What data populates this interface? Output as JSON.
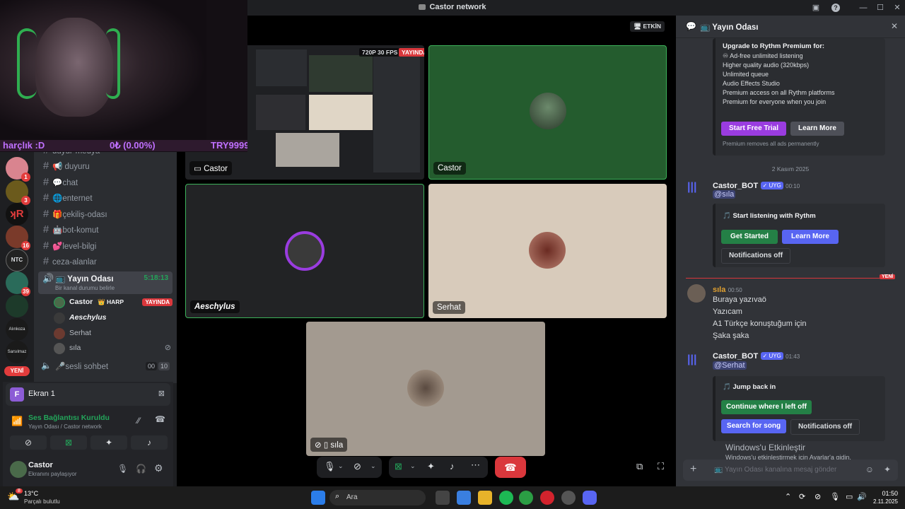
{
  "window": {
    "title": "Castor network"
  },
  "servers": [
    {
      "badge": "1"
    },
    {
      "badge": "3"
    },
    {
      "badge": ""
    },
    {
      "badge": "16"
    },
    {
      "badge": ""
    },
    {
      "badge": "39"
    },
    {
      "badge": ""
    },
    {
      "badge": ""
    },
    {
      "badge": ""
    },
    {
      "badge": "13"
    }
  ],
  "server_new_label": "YENİ",
  "channels": {
    "partial": "duyur-medya",
    "items": [
      "📢 duyuru",
      "💬chat",
      "🌐enternet",
      "🎁çekiliş-odası",
      "🤖bot-komut",
      "💕level-bilgi",
      "ceza-alanlar"
    ],
    "voice": {
      "name": "📺 Yayın Odası",
      "time": "5:18:13",
      "status": "Bir kanal durumu belirle",
      "members": [
        {
          "name": "Castor",
          "tag": "👑 HARP",
          "live": "YAYINDA"
        },
        {
          "name": "Aeschylus"
        },
        {
          "name": "Serhat"
        },
        {
          "name": "sıla"
        }
      ]
    },
    "voice2": {
      "name": "🎤sesli sohbet",
      "count1": "00",
      "count2": "10"
    }
  },
  "overlay": {
    "ticker_left": "harçlık :D",
    "ticker_mid": "0₺ (0.00%)",
    "ticker_right": "TRY999999"
  },
  "ekran": {
    "icon": "F",
    "name": "Ekran 1"
  },
  "voice_panel": {
    "status": "Ses Bağlantısı Kuruldu",
    "sub": "Yayın Odası / Castor network"
  },
  "user": {
    "name": "Castor",
    "status": "Ekranını paylaşıyor"
  },
  "stage": {
    "active_badge": "ETKİN",
    "stream_badge": "720P 30 FPS",
    "live_badge": "YAYINDA",
    "tiles": [
      "Castor",
      "Castor",
      "Aeschylus",
      "Serhat",
      "sıla"
    ]
  },
  "chat": {
    "header": "📺 Yayın Odası",
    "premium": {
      "title": "Upgrade to Rythm Premium for:",
      "items": [
        "♾ Ad-free unlimited listening",
        "Higher quality audio (320kbps)",
        "Unlimited queue",
        "Audio Effects Studio",
        "Premium access on all Rythm platforms",
        "Premium for everyone when you join"
      ],
      "btn_trial": "Start Free Trial",
      "btn_learn": "Learn More",
      "foot": "Premium removes all ads permanently"
    },
    "date": "2 Kasım 2025",
    "msg1": {
      "author": "Castor_BOT",
      "badge": "✓ UYG",
      "time": "00:10",
      "mention": "@sıla",
      "embed_title": "🎵 Start listening with Rythm",
      "b1": "Get Started",
      "b2": "Learn More",
      "b3": "Notifications off"
    },
    "new_label": "YENİ",
    "msg2": {
      "author": "sıla",
      "time": "00:50",
      "lines": [
        "Buraya yazıvaö",
        "Yazıcam",
        "A1 Türkçe konuştuğum için",
        "Şaka şaka"
      ]
    },
    "msg3": {
      "author": "Castor_BOT",
      "badge": "✓ UYG",
      "time": "01:43",
      "mention": "@Serhat",
      "embed_title": "🎵 Jump back in",
      "b1": "Continue where I left off",
      "b2": "Search for song",
      "b3": "Notifications off"
    },
    "input_placeholder": "📺 Yayın Odası kanalına mesaj gönder",
    "activate_title": "Windows'u Etkinleştir",
    "activate_sub": "Windows'u etkinleştirmek için Ayarlar'a gidin."
  },
  "taskbar": {
    "temp": "13°C",
    "weather": "Parçalı bulutlu",
    "weather_badge": "8",
    "search": "Ara",
    "time": "01:50",
    "date": "2.11.2025"
  }
}
